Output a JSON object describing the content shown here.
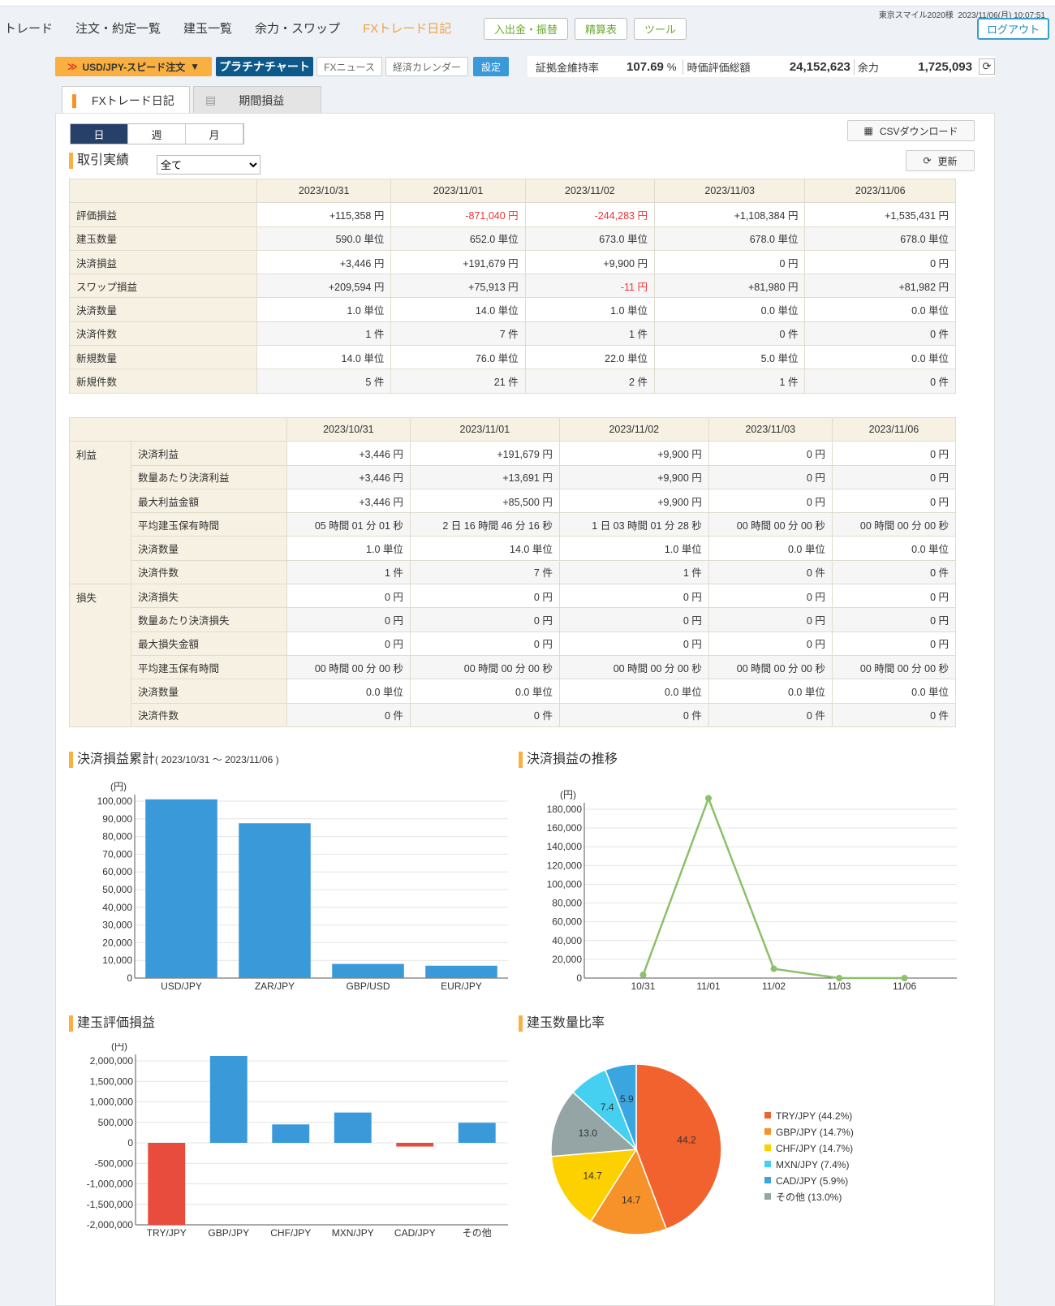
{
  "header": {
    "user": "東京スマイル2020様",
    "datetime": "2023/11/06(月) 10:07:51",
    "nav": [
      "トレード",
      "注文・約定一覧",
      "建玉一覧",
      "余力・スワップ",
      "FXトレード日記"
    ],
    "buttons": [
      "入出金・振替",
      "精算表",
      "ツール"
    ],
    "logout": "ログアウト"
  },
  "toolbar": {
    "speed_order": "USD/JPY-スピード注文",
    "platinum": "プラチナチャート",
    "news": "FXニュース",
    "calendar": "経済カレンダー",
    "settings": "設定",
    "margin_label": "証拠金維持率",
    "margin_value": "107.69",
    "margin_unit": "%",
    "valuation_label": "時価評価総額",
    "valuation_value": "24,152,623",
    "yoryoku_label": "余力",
    "yoryoku_value": "1,725,093"
  },
  "tabs": [
    "FXトレード日記",
    "期間損益"
  ],
  "period": [
    "日",
    "週",
    "月"
  ],
  "csv": "CSVダウンロード",
  "refresh": "更新",
  "section_trade": "取引実績",
  "filter": "全て",
  "dates": [
    "2023/10/31",
    "2023/11/01",
    "2023/11/02",
    "2023/11/03",
    "2023/11/06"
  ],
  "table1": [
    {
      "label": "評価損益",
      "values": [
        "+115,358 円",
        "-871,040 円",
        "-244,283 円",
        "+1,108,384 円",
        "+1,535,431 円"
      ]
    },
    {
      "label": "建玉数量",
      "values": [
        "590.0 単位",
        "652.0 単位",
        "673.0 単位",
        "678.0 単位",
        "678.0 単位"
      ]
    },
    {
      "label": "決済損益",
      "values": [
        "+3,446 円",
        "+191,679 円",
        "+9,900 円",
        "0 円",
        "0 円"
      ]
    },
    {
      "label": "スワップ損益",
      "values": [
        "+209,594 円",
        "+75,913 円",
        "-11 円",
        "+81,980 円",
        "+81,982 円"
      ]
    },
    {
      "label": "決済数量",
      "values": [
        "1.0 単位",
        "14.0 単位",
        "1.0 単位",
        "0.0 単位",
        "0.0 単位"
      ]
    },
    {
      "label": "決済件数",
      "values": [
        "1 件",
        "7 件",
        "1 件",
        "0 件",
        "0 件"
      ]
    },
    {
      "label": "新規数量",
      "values": [
        "14.0 単位",
        "76.0 単位",
        "22.0 単位",
        "5.0 単位",
        "0.0 単位"
      ]
    },
    {
      "label": "新規件数",
      "values": [
        "5 件",
        "21 件",
        "2 件",
        "1 件",
        "0 件"
      ]
    }
  ],
  "table2": [
    {
      "group": "利益",
      "rows": [
        {
          "label": "決済利益",
          "values": [
            "+3,446 円",
            "+191,679 円",
            "+9,900 円",
            "0 円",
            "0 円"
          ]
        },
        {
          "label": "数量あたり決済利益",
          "values": [
            "+3,446 円",
            "+13,691 円",
            "+9,900 円",
            "0 円",
            "0 円"
          ]
        },
        {
          "label": "最大利益金額",
          "values": [
            "+3,446 円",
            "+85,500 円",
            "+9,900 円",
            "0 円",
            "0 円"
          ]
        },
        {
          "label": "平均建玉保有時間",
          "values": [
            "05 時間 01 分 01 秒",
            "2 日 16 時間 46 分 16 秒",
            "1 日 03 時間 01 分 28 秒",
            "00 時間 00 分 00 秒",
            "00 時間 00 分 00 秒"
          ]
        },
        {
          "label": "決済数量",
          "values": [
            "1.0 単位",
            "14.0 単位",
            "1.0 単位",
            "0.0 単位",
            "0.0 単位"
          ]
        },
        {
          "label": "決済件数",
          "values": [
            "1 件",
            "7 件",
            "1 件",
            "0 件",
            "0 件"
          ]
        }
      ]
    },
    {
      "group": "損失",
      "rows": [
        {
          "label": "決済損失",
          "values": [
            "0 円",
            "0 円",
            "0 円",
            "0 円",
            "0 円"
          ]
        },
        {
          "label": "数量あたり決済損失",
          "values": [
            "0 円",
            "0 円",
            "0 円",
            "0 円",
            "0 円"
          ]
        },
        {
          "label": "最大損失金額",
          "values": [
            "0 円",
            "0 円",
            "0 円",
            "0 円",
            "0 円"
          ]
        },
        {
          "label": "平均建玉保有時間",
          "values": [
            "00 時間 00 分 00 秒",
            "00 時間 00 分 00 秒",
            "00 時間 00 分 00 秒",
            "00 時間 00 分 00 秒",
            "00 時間 00 分 00 秒"
          ]
        },
        {
          "label": "決済数量",
          "values": [
            "0.0 単位",
            "0.0 単位",
            "0.0 単位",
            "0.0 単位",
            "0.0 単位"
          ]
        },
        {
          "label": "決済件数",
          "values": [
            "0 件",
            "0 件",
            "0 件",
            "0 件",
            "0 件"
          ]
        }
      ]
    }
  ],
  "chart_data": [
    {
      "type": "bar",
      "title": "決済損益累計",
      "subtitle": "( 2023/10/31 ～ 2023/11/06 )",
      "ylabel": "(円)",
      "categories": [
        "USD/JPY",
        "ZAR/JPY",
        "GBP/USD",
        "EUR/JPY"
      ],
      "values": [
        101000,
        87500,
        8000,
        7000
      ],
      "ylim": [
        0,
        100000
      ],
      "yticks": [
        0,
        10000,
        20000,
        30000,
        40000,
        50000,
        60000,
        70000,
        80000,
        90000,
        100000
      ]
    },
    {
      "type": "line",
      "title": "決済損益の推移",
      "ylabel": "(円)",
      "categories": [
        "10/31",
        "11/01",
        "11/02",
        "11/03",
        "11/06"
      ],
      "values": [
        3446,
        191679,
        9900,
        0,
        0
      ],
      "ylim": [
        0,
        180000
      ],
      "yticks": [
        0,
        20000,
        40000,
        60000,
        80000,
        100000,
        120000,
        140000,
        160000,
        180000
      ],
      "color": "#8cc06a"
    },
    {
      "type": "bar",
      "title": "建玉評価損益",
      "ylabel": "(円)",
      "categories": [
        "TRY/JPY",
        "GBP/JPY",
        "CHF/JPY",
        "MXN/JPY",
        "CAD/JPY",
        "その他"
      ],
      "values": [
        -2230000,
        2240000,
        450000,
        740000,
        -90000,
        490000
      ],
      "ylim": [
        -2000000,
        2000000
      ],
      "yticks": [
        -2000000,
        -1500000,
        -1000000,
        -500000,
        0,
        500000,
        1000000,
        1500000,
        2000000
      ],
      "pos_color": "#3a9ad9",
      "neg_color": "#e84c3d"
    },
    {
      "type": "pie",
      "title": "建玉数量比率",
      "labels": [
        "TRY/JPY",
        "GBP/JPY",
        "CHF/JPY",
        "MXN/JPY",
        "CAD/JPY",
        "その他"
      ],
      "values": [
        44.2,
        14.7,
        14.7,
        7.4,
        5.9,
        13.0
      ],
      "legend": [
        "TRY/JPY (44.2%)",
        "GBP/JPY (14.7%)",
        "CHF/JPY (14.7%)",
        "MXN/JPY (7.4%)",
        "CAD/JPY (5.9%)",
        "その他 (13.0%)"
      ],
      "colors": [
        "#f2622e",
        "#f7922a",
        "#fdd000",
        "#45d0f2",
        "#3aa6e0",
        "#95a5a6"
      ],
      "legend_position": "right"
    }
  ]
}
